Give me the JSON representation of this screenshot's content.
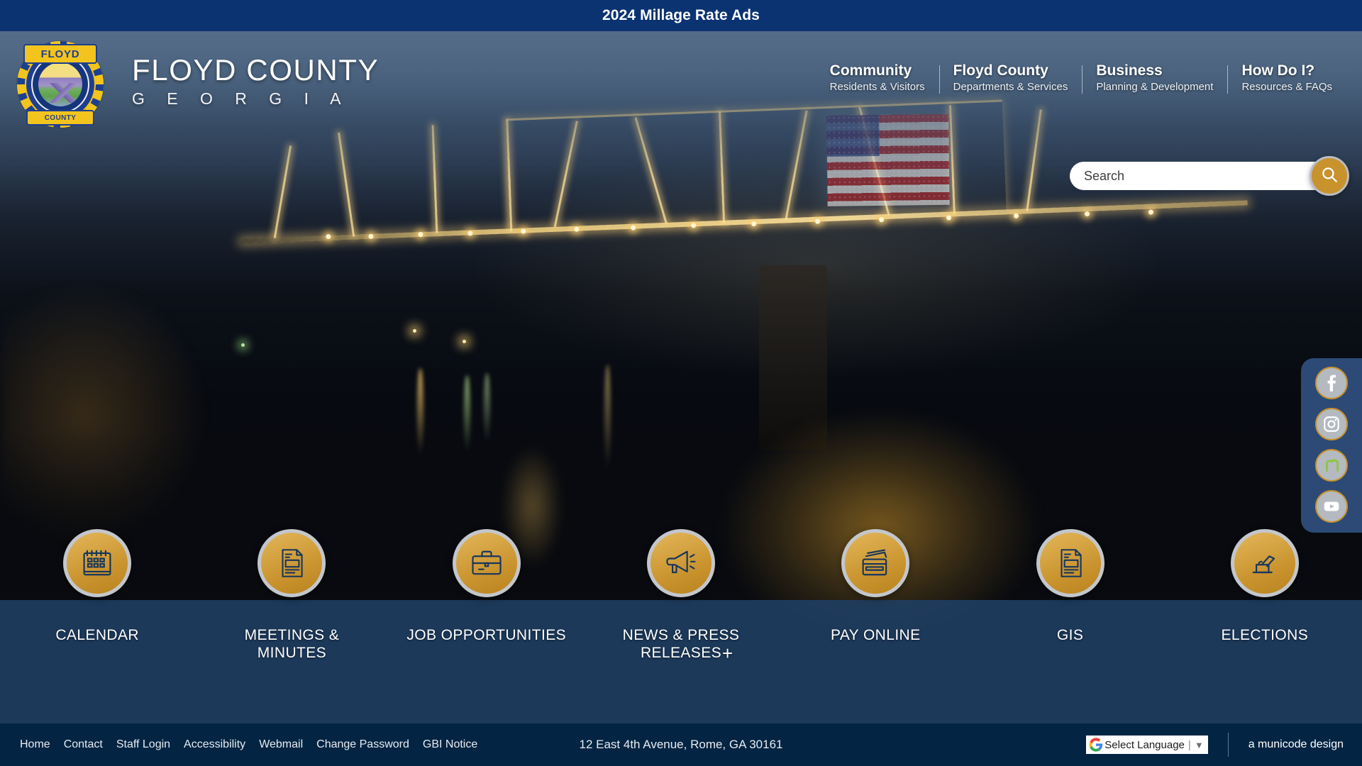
{
  "alert": {
    "text": "2024 Millage Rate Ads"
  },
  "brand": {
    "seal_top": "FLOYD",
    "seal_bottom": "COUNTY",
    "title": "FLOYD COUNTY",
    "subtitle": "G E O R G I A",
    "seal_icon": "county-seal-icon"
  },
  "nav": {
    "items": [
      {
        "title": "Community",
        "sub": "Residents & Visitors"
      },
      {
        "title": "Floyd County",
        "sub": "Departments & Services"
      },
      {
        "title": "Business",
        "sub": "Planning & Development"
      },
      {
        "title": "How Do I?",
        "sub": "Resources & FAQs"
      }
    ]
  },
  "search": {
    "placeholder": "Search",
    "value": "",
    "button_icon": "search-icon"
  },
  "social": {
    "items": [
      {
        "name": "facebook",
        "label": "Facebook"
      },
      {
        "name": "instagram",
        "label": "Instagram"
      },
      {
        "name": "nextdoor",
        "label": "Nextdoor"
      },
      {
        "name": "youtube",
        "label": "YouTube"
      }
    ]
  },
  "quick_links": {
    "plus_mark": "+",
    "items": [
      {
        "label": "CALENDAR",
        "icon": "calendar-icon"
      },
      {
        "label": "MEETINGS & MINUTES",
        "icon": "document-icon"
      },
      {
        "label": "JOB OPPORTUNITIES",
        "icon": "briefcase-icon"
      },
      {
        "label": "NEWS & PRESS RELEASES",
        "icon": "megaphone-icon"
      },
      {
        "label": "PAY ONLINE",
        "icon": "credit-card-icon"
      },
      {
        "label": "GIS",
        "icon": "document-icon"
      },
      {
        "label": "ELECTIONS",
        "icon": "ballot-hand-icon"
      }
    ]
  },
  "footer": {
    "links": [
      "Home",
      "Contact",
      "Staff Login",
      "Accessibility",
      "Webmail",
      "Change Password",
      "GBI Notice"
    ],
    "address": "12 East 4th Avenue, Rome, GA 30161",
    "translate_label": "Select Language",
    "translate_sep": "|",
    "translate_caret": "▼",
    "credit": "a municode design"
  },
  "colors": {
    "alert_blue": "#0b3372",
    "footer_navy": "#032442",
    "band_blue": "#1f3e63",
    "gold": "#c8922d",
    "silver": "#c3c7cb"
  }
}
